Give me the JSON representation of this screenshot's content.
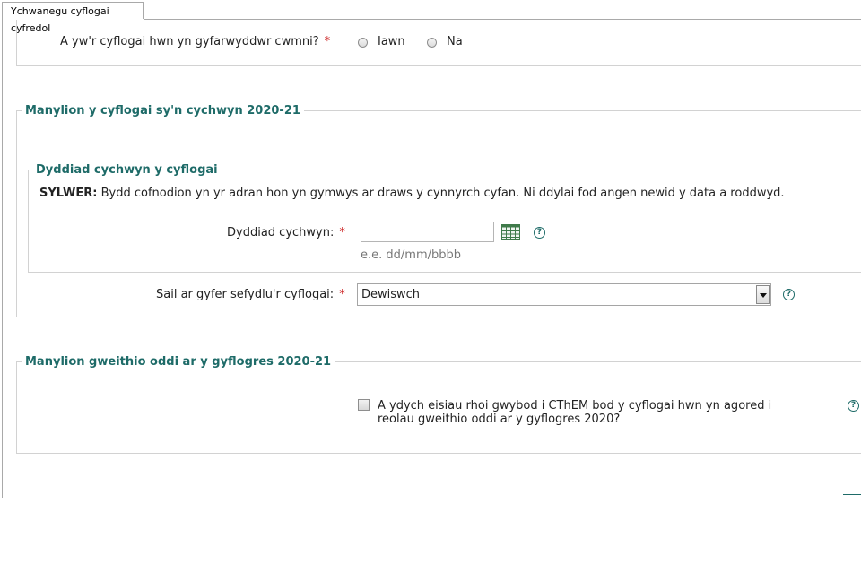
{
  "tab": {
    "label": "Ychwanegu cyflogai cyfredol"
  },
  "director_question": {
    "label": "A yw'r cyflogai hwn yn gyfarwyddwr cwmni?",
    "required_mark": "*",
    "options": [
      "Iawn",
      "Na"
    ]
  },
  "starter_details": {
    "legend": "Manylion y cyflogai sy'n cychwyn 2020-21",
    "start_date": {
      "legend": "Dyddiad cychwyn y cyflogai",
      "note_prefix": "SYLWER:",
      "note_text": " Bydd cofnodion yn yr adran hon yn gymwys ar draws y cynnyrch cyfan. Ni ddylai fod angen newid y data a roddwyd.",
      "label": "Dyddiad cychwyn:",
      "required_mark": "*",
      "value": "",
      "hint": "e.e. dd/mm/bbbb"
    },
    "basis": {
      "label": "Sail ar gyfer sefydlu'r cyflogai:",
      "required_mark": "*",
      "selected": "Dewiswch"
    }
  },
  "offpayroll": {
    "legend": "Manylion gweithio oddi ar y gyflogres 2020-21",
    "checkbox_label": "A ydych eisiau rhoi gwybod i CThEM bod y cyflogai hwn yn agored i reolau gweithio oddi ar y gyflogres 2020?",
    "checked": false
  },
  "help_glyph": "?",
  "colors": {
    "accent": "#1e6b68",
    "required": "#cc2222"
  }
}
